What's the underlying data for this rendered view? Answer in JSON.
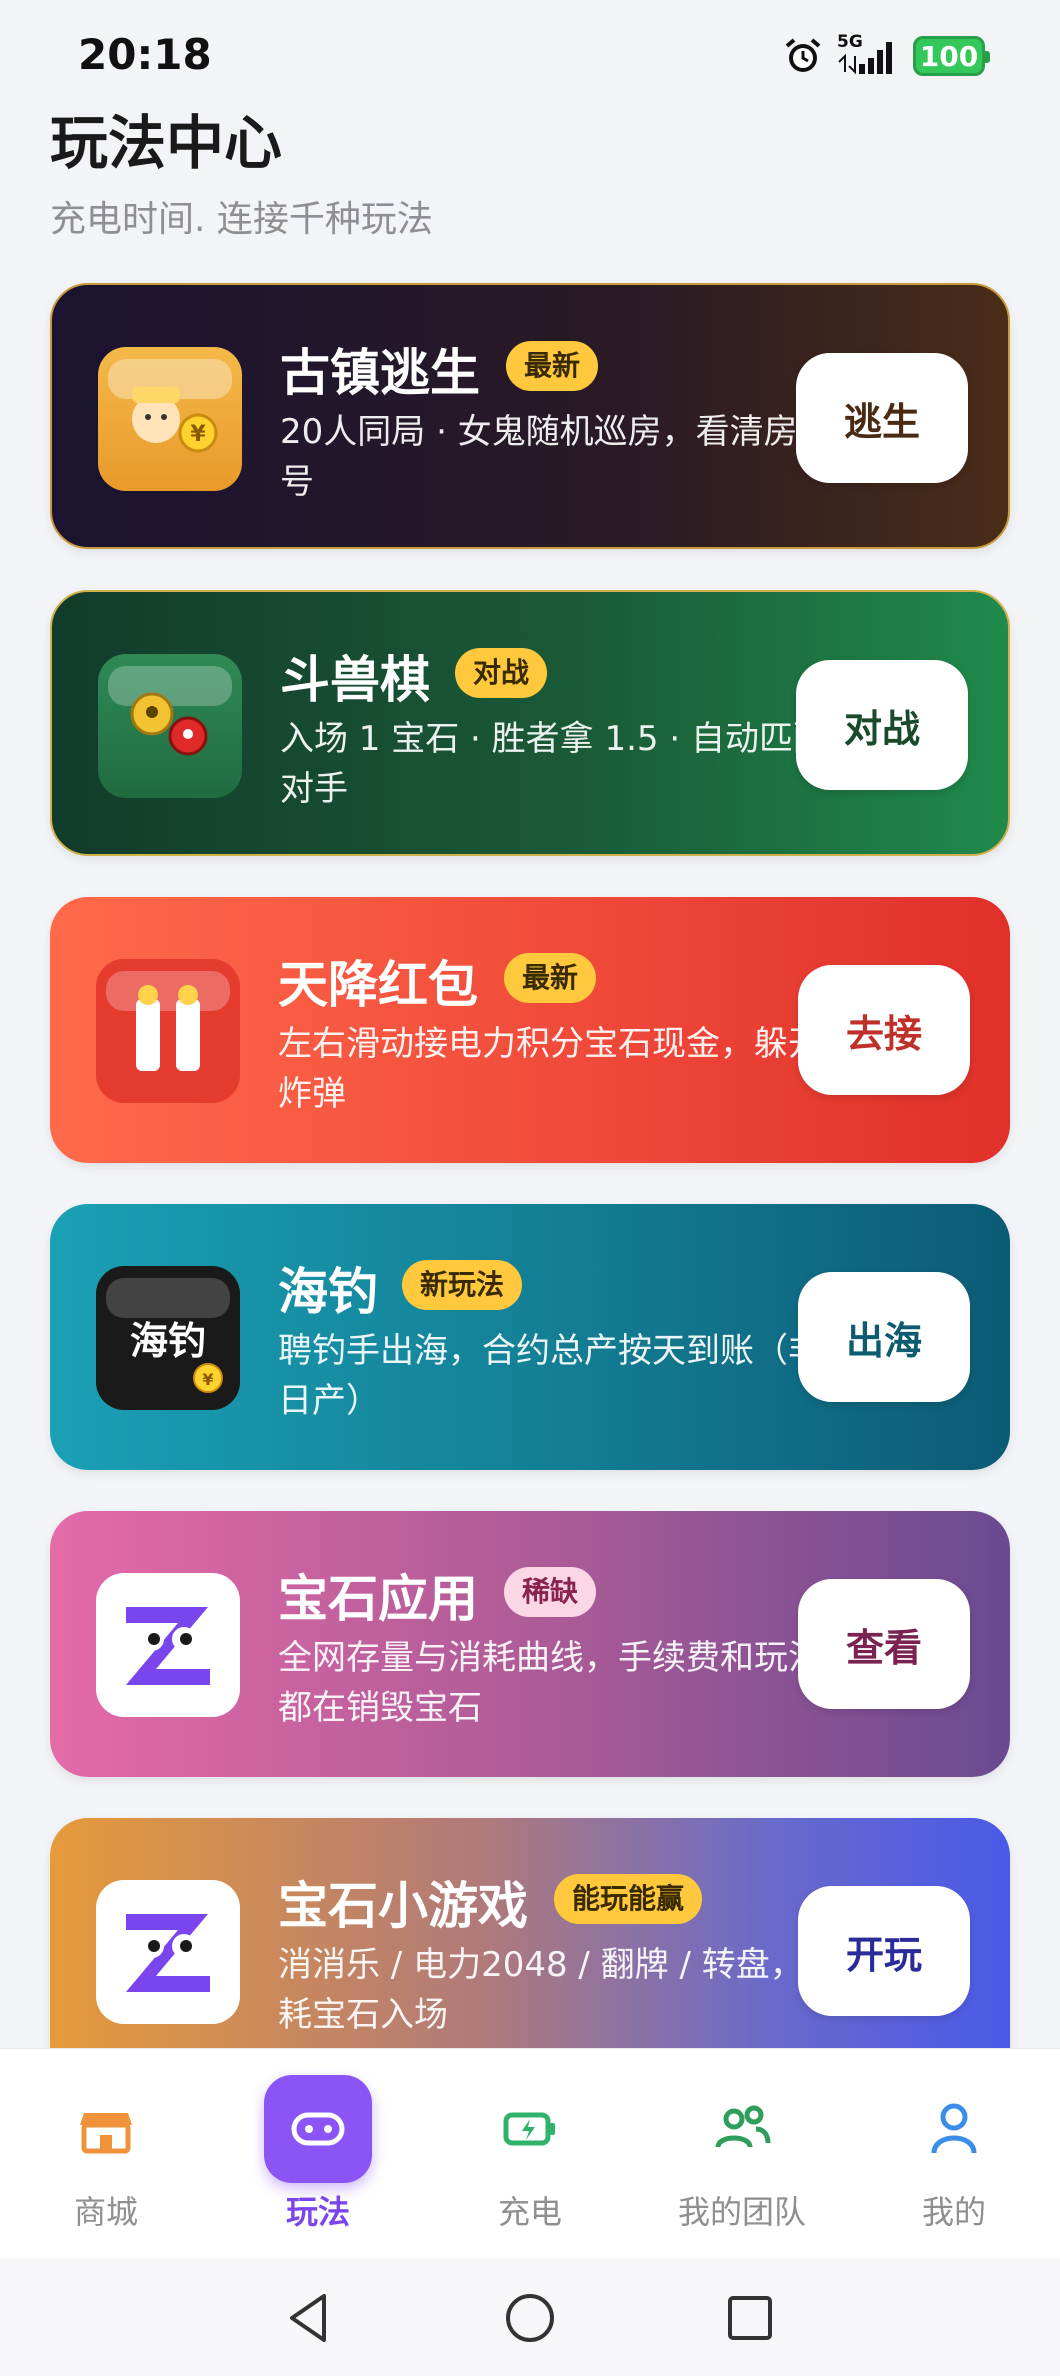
{
  "status_bar": {
    "time": "20:18",
    "network": "5G",
    "battery": "100",
    "icons": [
      "alarm-icon",
      "signal-icon",
      "battery-icon"
    ]
  },
  "header": {
    "title": "玩法中心",
    "subtitle": "充电时间. 连接千种玩法"
  },
  "cards": [
    {
      "title": "古镇逃生",
      "badge": "最新",
      "desc": "20人同局 · 女鬼随机巡房，看清房间号",
      "button": "逃生",
      "button_color": "#4a2a12",
      "icon": "ghost-town-icon"
    },
    {
      "title": "斗兽棋",
      "badge": "对战",
      "desc": "入场 1 宝石 · 胜者拿 1.5 · 自动匹配对手",
      "button": "对战",
      "button_color": "#1a4a2a",
      "icon": "animal-chess-icon"
    },
    {
      "title": "天降红包",
      "badge": "最新",
      "desc": "左右滑动接电力积分宝石现金，躲开炸弹",
      "button": "去接",
      "button_color": "#c0302a",
      "icon": "red-packet-icon"
    },
    {
      "title": "海钓",
      "badge": "新玩法",
      "desc": "聘钓手出海，合约总产按天到账（非日产）",
      "button": "出海",
      "button_color": "#0c5b6e",
      "icon": "fishing-icon",
      "icon_text": "海钓"
    },
    {
      "title": "宝石应用",
      "badge": "稀缺",
      "desc": "全网存量与消耗曲线，手续费和玩法都在销毁宝石",
      "button": "查看",
      "button_color": "#7a2350",
      "icon": "gem-app-icon"
    },
    {
      "title": "宝石小游戏",
      "badge": "能玩能赢",
      "desc": "消消乐 / 电力2048 / 翻牌 / 转盘，消耗宝石入场",
      "button": "开玩",
      "button_color": "#2a2a9a",
      "icon": "gem-game-icon"
    }
  ],
  "tabs": [
    {
      "label": "商城",
      "icon": "store-icon",
      "color": "#f0923a"
    },
    {
      "label": "玩法",
      "icon": "gamepad-icon",
      "color": "#8b55f5",
      "active": true
    },
    {
      "label": "充电",
      "icon": "charge-icon",
      "color": "#2fb36a"
    },
    {
      "label": "我的团队",
      "icon": "team-icon",
      "color": "#2f9e5a"
    },
    {
      "label": "我的",
      "icon": "user-icon",
      "color": "#3a8ee8"
    }
  ],
  "nav": [
    "back-icon",
    "home-icon",
    "recents-icon"
  ]
}
